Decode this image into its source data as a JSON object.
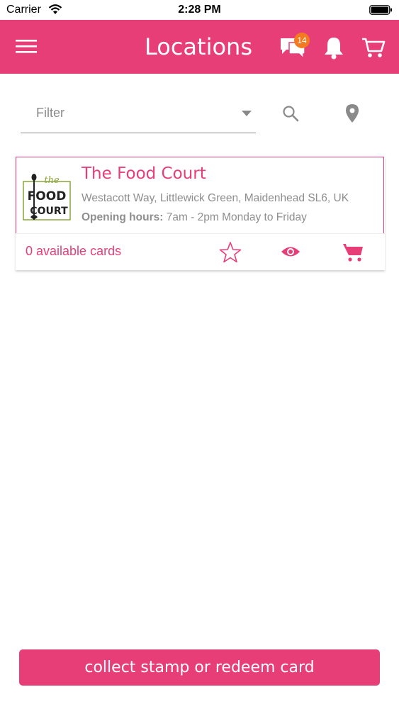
{
  "status_bar": {
    "carrier": "Carrier",
    "time": "2:28 PM"
  },
  "nav": {
    "title": "Locations",
    "chat_badge_count": "14"
  },
  "filter": {
    "placeholder": "Filter"
  },
  "locations": [
    {
      "name": "The Food Court",
      "address": "Westacott Way, Littlewick Green, Maidenhead SL6, UK",
      "hours_label": "Opening hours:",
      "hours_value": "7am - 2pm Monday to Friday",
      "available_cards": "0 available cards",
      "logo_text_top": "the",
      "logo_text_mid": "FOOD",
      "logo_text_bottom": "COURT"
    }
  ],
  "actions": {
    "collect_label": "collect stamp or redeem card"
  },
  "colors": {
    "brand": "#e83e77",
    "badge": "#f47a20",
    "muted": "#8e8e8e"
  },
  "icons": {
    "menu": "hamburger-icon",
    "chat": "chat-bubbles-icon",
    "bell": "bell-icon",
    "cart": "cart-icon",
    "search": "search-icon",
    "pin": "location-pin-icon",
    "star": "star-icon",
    "eye": "eye-icon"
  }
}
